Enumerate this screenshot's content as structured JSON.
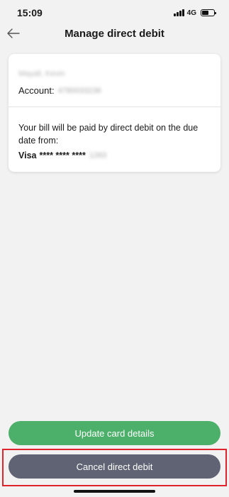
{
  "status": {
    "time": "15:09",
    "network": "4G",
    "battery_level": 0.55
  },
  "header": {
    "title": "Manage direct debit",
    "back_icon": "arrow-left-icon"
  },
  "card": {
    "name": "Mayall, Kevin",
    "account_label": "Account:",
    "account_number": "4780033236",
    "bill_text": "Your bill will be paid by direct debit on the due date from:",
    "card_brand": "Visa",
    "card_mask": "**** **** ****",
    "card_last4": "1263"
  },
  "actions": {
    "update_label": "Update card details",
    "cancel_label": "Cancel direct debit",
    "update_color": "#4caf6a",
    "cancel_color": "#5f6373",
    "highlight_color": "#e0242b"
  }
}
